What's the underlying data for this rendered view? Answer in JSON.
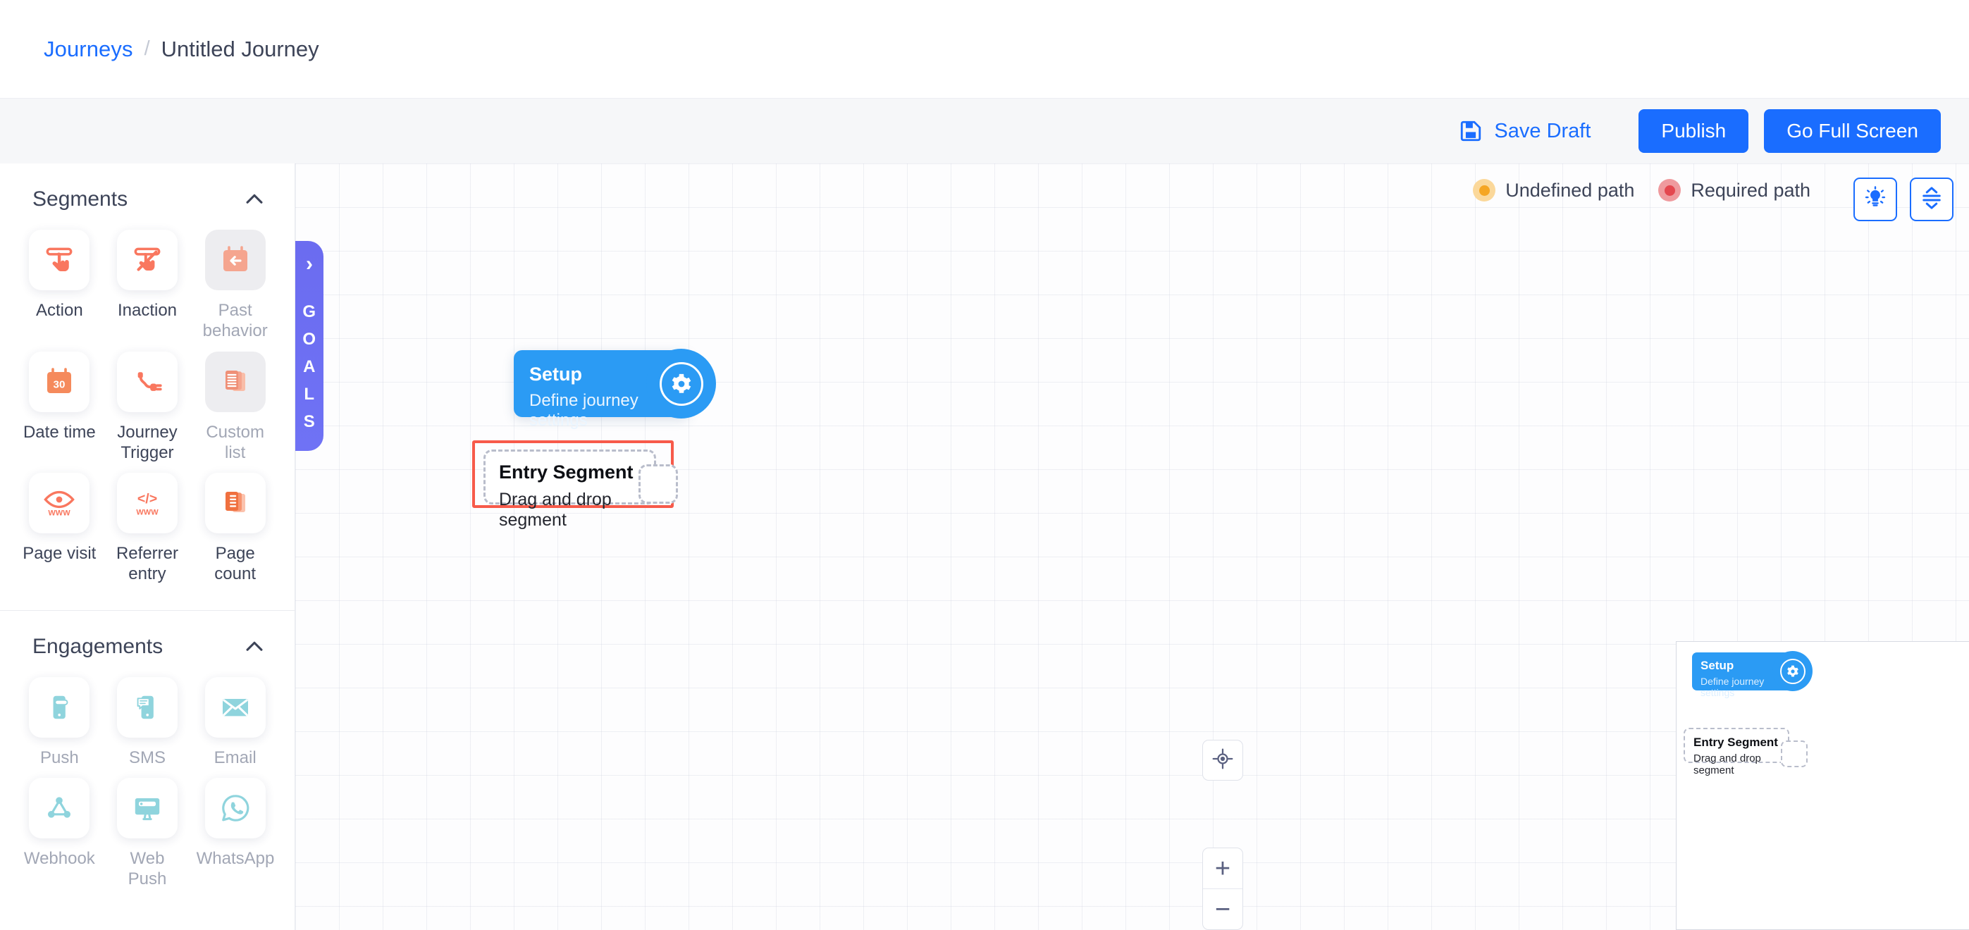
{
  "breadcrumb": {
    "parent": "Journeys",
    "separator": "/",
    "current": "Untitled Journey"
  },
  "toolbar": {
    "save_draft_label": "Save Draft",
    "publish_label": "Publish",
    "fullscreen_label": "Go Full Screen",
    "accent_color": "#1a6dff"
  },
  "sidebar": {
    "sections": [
      {
        "title": "Segments",
        "collapse_icon": "chevron-up-icon",
        "items": [
          {
            "label": "Action",
            "icon": "tap-action-icon",
            "state": "enabled"
          },
          {
            "label": "Inaction",
            "icon": "no-tap-action-icon",
            "state": "enabled"
          },
          {
            "label": "Past behavior",
            "icon": "calendar-back-arrow-icon",
            "state": "disabled"
          },
          {
            "label": "Date time",
            "icon": "calendar-30-icon",
            "state": "enabled"
          },
          {
            "label": "Journey Trigger",
            "icon": "plug-connector-icon",
            "state": "enabled"
          },
          {
            "label": "Custom list",
            "icon": "stacked-pages-icon",
            "state": "disabled"
          },
          {
            "label": "Page visit",
            "icon": "eye-www-icon",
            "state": "enabled"
          },
          {
            "label": "Referrer entry",
            "icon": "code-www-icon",
            "state": "enabled"
          },
          {
            "label": "Page count",
            "icon": "page-count-icon",
            "state": "enabled"
          }
        ]
      },
      {
        "title": "Engagements",
        "collapse_icon": "chevron-up-icon",
        "items": [
          {
            "label": "Push",
            "icon": "mobile-push-icon",
            "state": "muted"
          },
          {
            "label": "SMS",
            "icon": "mobile-sms-icon",
            "state": "muted"
          },
          {
            "label": "Email",
            "icon": "envelope-icon",
            "state": "muted"
          },
          {
            "label": "Webhook",
            "icon": "webhook-icon",
            "state": "muted"
          },
          {
            "label": "Web Push",
            "icon": "desktop-push-icon",
            "state": "muted"
          },
          {
            "label": "WhatsApp",
            "icon": "whatsapp-icon",
            "state": "muted"
          }
        ]
      }
    ]
  },
  "canvas": {
    "goals_tab": {
      "chevron": "›",
      "letters": [
        "G",
        "O",
        "A",
        "L",
        "S"
      ],
      "color": "#6b6cf0"
    },
    "legend": [
      {
        "label": "Undefined path",
        "color": "#f5a623",
        "ring": "#fbd89a"
      },
      {
        "label": "Required path",
        "color": "#e4474f",
        "ring": "#ef9a9e"
      }
    ],
    "tools": [
      {
        "name": "tips-button",
        "icon": "lightbulb-icon"
      },
      {
        "name": "auto-arrange-button",
        "icon": "vertical-distribute-icon"
      }
    ],
    "nodes": {
      "setup": {
        "title": "Setup",
        "subtitle": "Define journey settings",
        "icon": "gear-icon",
        "color": "#2b9bf4"
      },
      "entry_segment": {
        "title": "Entry Segment",
        "subtitle": "Drag and drop segment",
        "highlight_color": "#f75a4a"
      }
    },
    "controls": {
      "center_icon": "crosshair-icon",
      "zoom_in": "+",
      "zoom_out": "−"
    }
  }
}
